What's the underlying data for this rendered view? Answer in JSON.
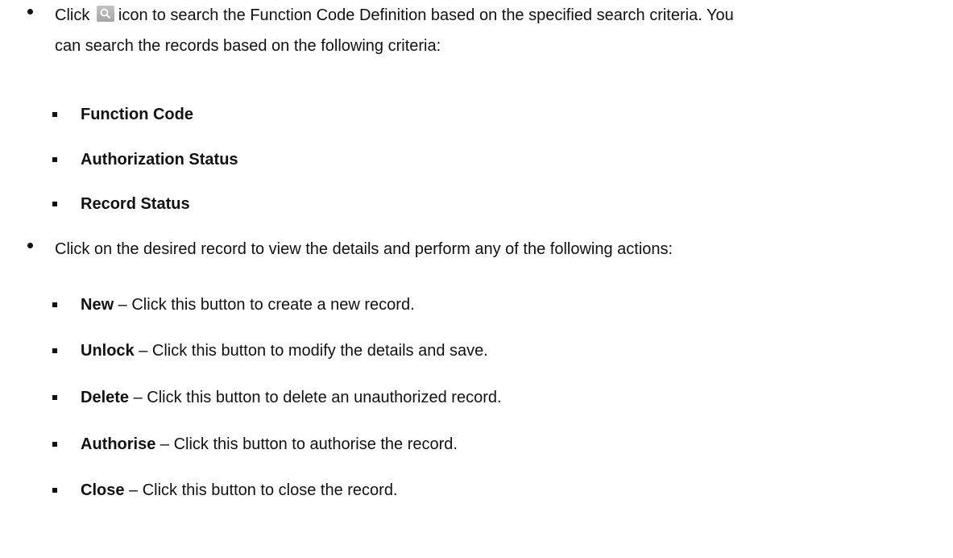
{
  "intro": {
    "line1_before_icon": "Click",
    "icon": "search-icon",
    "line1_after_icon": "icon to search the Function Code Definition based on the specified search criteria. You",
    "line2": "can search the records based on the following criteria:"
  },
  "criteria": [
    "Function Code",
    "Authorization Status",
    "Record Status"
  ],
  "actions_intro": "Click on the desired record to view the details and perform any of the following actions:",
  "actions": [
    {
      "name": "New",
      "desc": " – Click this button to create a new record."
    },
    {
      "name": "Unlock",
      "desc": " – Click this button to modify the details and save."
    },
    {
      "name": "Delete",
      "desc": " – Click this button to delete an unauthorized record."
    },
    {
      "name": "Authorise",
      "desc": " – Click this button to authorise the record."
    },
    {
      "name": "Close",
      "desc": " – Click this button to close the record."
    }
  ]
}
